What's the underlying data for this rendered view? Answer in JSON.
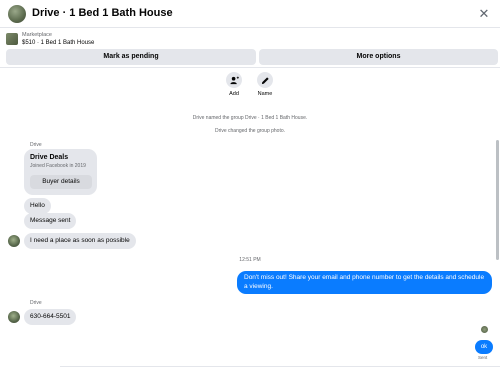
{
  "header": {
    "title": "Drive · 1 Bed 1 Bath House",
    "close_glyph": "✕"
  },
  "listing": {
    "category": "Marketplace",
    "price_title": "$510 · 1 Bed 1 Bath House",
    "mark_pending_label": "Mark as pending",
    "more_options_label": "More options"
  },
  "actions": {
    "add_label": "Add",
    "name_label": "Name"
  },
  "system_messages": [
    "Drive named the group Drive · 1 Bed 1 Bath House.",
    "Drive changed the group photo."
  ],
  "incoming": {
    "sender": "Drive",
    "card_title": "Drive Deals",
    "card_subtitle": "Joined Facebook in 2019",
    "card_button": "Buyer details",
    "msg_hello": "Hello",
    "msg_sent": "Message sent",
    "msg_need": "I need a place as soon as possible"
  },
  "timestamp": "12:51 PM",
  "outgoing": {
    "message": "Don't miss out! Share your email and phone number to get the details and schedule a viewing."
  },
  "incoming2": {
    "sender": "Drive",
    "phone": "630-664-5501"
  },
  "reply": {
    "text": "ok",
    "status": "Sent"
  },
  "colors": {
    "accent": "#0a7cff",
    "bubble_gray": "#e4e6eb",
    "muted_text": "#65676b"
  }
}
